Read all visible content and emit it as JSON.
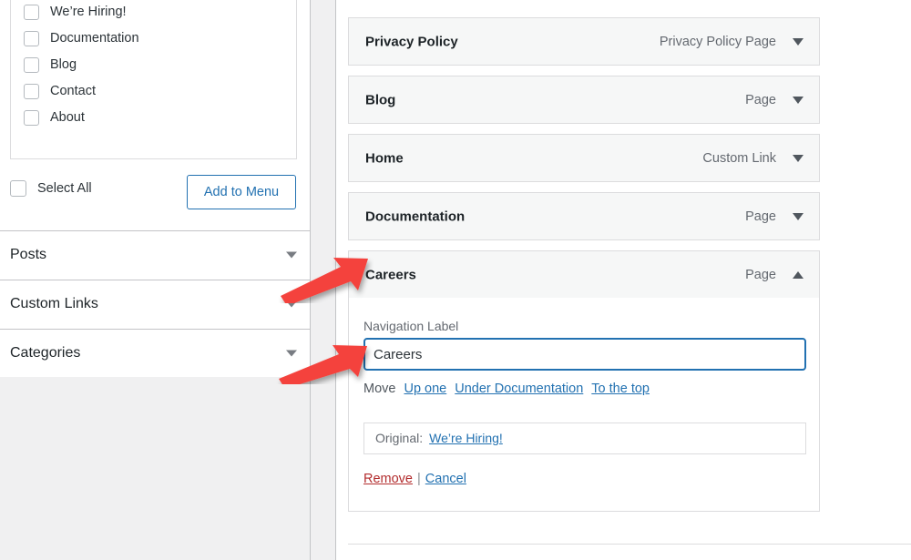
{
  "left_panel": {
    "available_items": {
      "checkboxes": [
        {
          "label": "We’re Hiring!",
          "checked": false
        },
        {
          "label": "Documentation",
          "checked": false
        },
        {
          "label": "Blog",
          "checked": false
        },
        {
          "label": "Contact",
          "checked": false
        },
        {
          "label": "About",
          "checked": false
        }
      ]
    },
    "select_all_label": "Select All",
    "add_to_menu_label": "Add to Menu",
    "accordions": [
      {
        "title": "Posts",
        "arrow": "chevron-down-icon",
        "expanded": false
      },
      {
        "title": "Custom Links",
        "arrow": "chevron-down-icon",
        "expanded": false
      },
      {
        "title": "Categories",
        "arrow": "chevron-down-icon",
        "expanded": false
      }
    ]
  },
  "right_panel": {
    "menu_items": [
      {
        "title": "Privacy Policy",
        "type": "Privacy Policy Page",
        "expanded": false,
        "arrow": "chevron-down-icon"
      },
      {
        "title": "Blog",
        "type": "Page",
        "expanded": false,
        "arrow": "chevron-down-icon"
      },
      {
        "title": "Home",
        "type": "Custom Link",
        "expanded": false,
        "arrow": "chevron-down-icon"
      },
      {
        "title": "Documentation",
        "type": "Page",
        "expanded": false,
        "arrow": "chevron-down-icon"
      },
      {
        "title": "Careers",
        "type": "Page",
        "expanded": true,
        "arrow": "chevron-up-icon"
      }
    ],
    "item_settings": {
      "nav_label_field_label": "Navigation Label",
      "nav_label_value": "Careers",
      "nav_label_placeholder": "",
      "move_word": "Move",
      "move_links": [
        {
          "label": "Up one"
        },
        {
          "label": "Under Documentation"
        },
        {
          "label": "To the top"
        }
      ],
      "original_label": "Original:",
      "original_link": "We’re Hiring!",
      "remove_label": "Remove",
      "separator": "|",
      "cancel_label": "Cancel"
    }
  },
  "colors": {
    "accent_blue": "#2271b1",
    "remove_red": "#b32d2e",
    "annotation_red": "#f4433c",
    "panel_gray": "#f0f0f1",
    "item_header_bg": "#f6f7f7",
    "border_gray": "#dcdcde"
  }
}
